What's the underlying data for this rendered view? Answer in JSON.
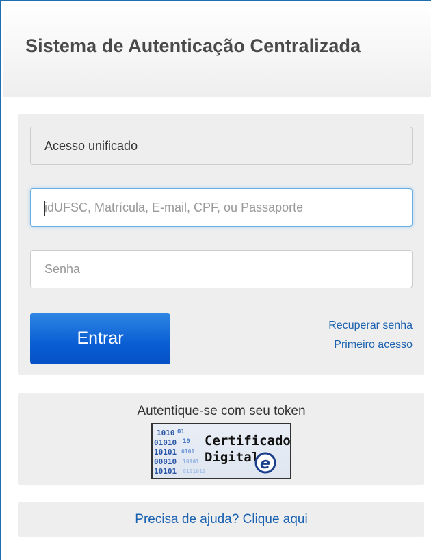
{
  "header": {
    "title": "Sistema de Autenticação Centralizada"
  },
  "login": {
    "access_type_value": "Acesso unificado",
    "username_placeholder": "idUFSC, Matrícula, E-mail, CPF, ou Passaporte",
    "password_placeholder": "Senha",
    "submit_label": "Entrar",
    "recover_password_label": "Recuperar senha",
    "first_access_label": "Primeiro acesso"
  },
  "token": {
    "label": "Autentique-se com seu token",
    "badge_line1": "Certificado",
    "badge_line2": "Digital",
    "badge_mark": "e"
  },
  "help": {
    "label": "Precisa de ajuda? Clique aqui"
  },
  "colors": {
    "primary_button": "#0a5ed4",
    "link": "#1a61b0",
    "panel_bg": "#eeeeee",
    "focus_border": "#66afe9"
  }
}
